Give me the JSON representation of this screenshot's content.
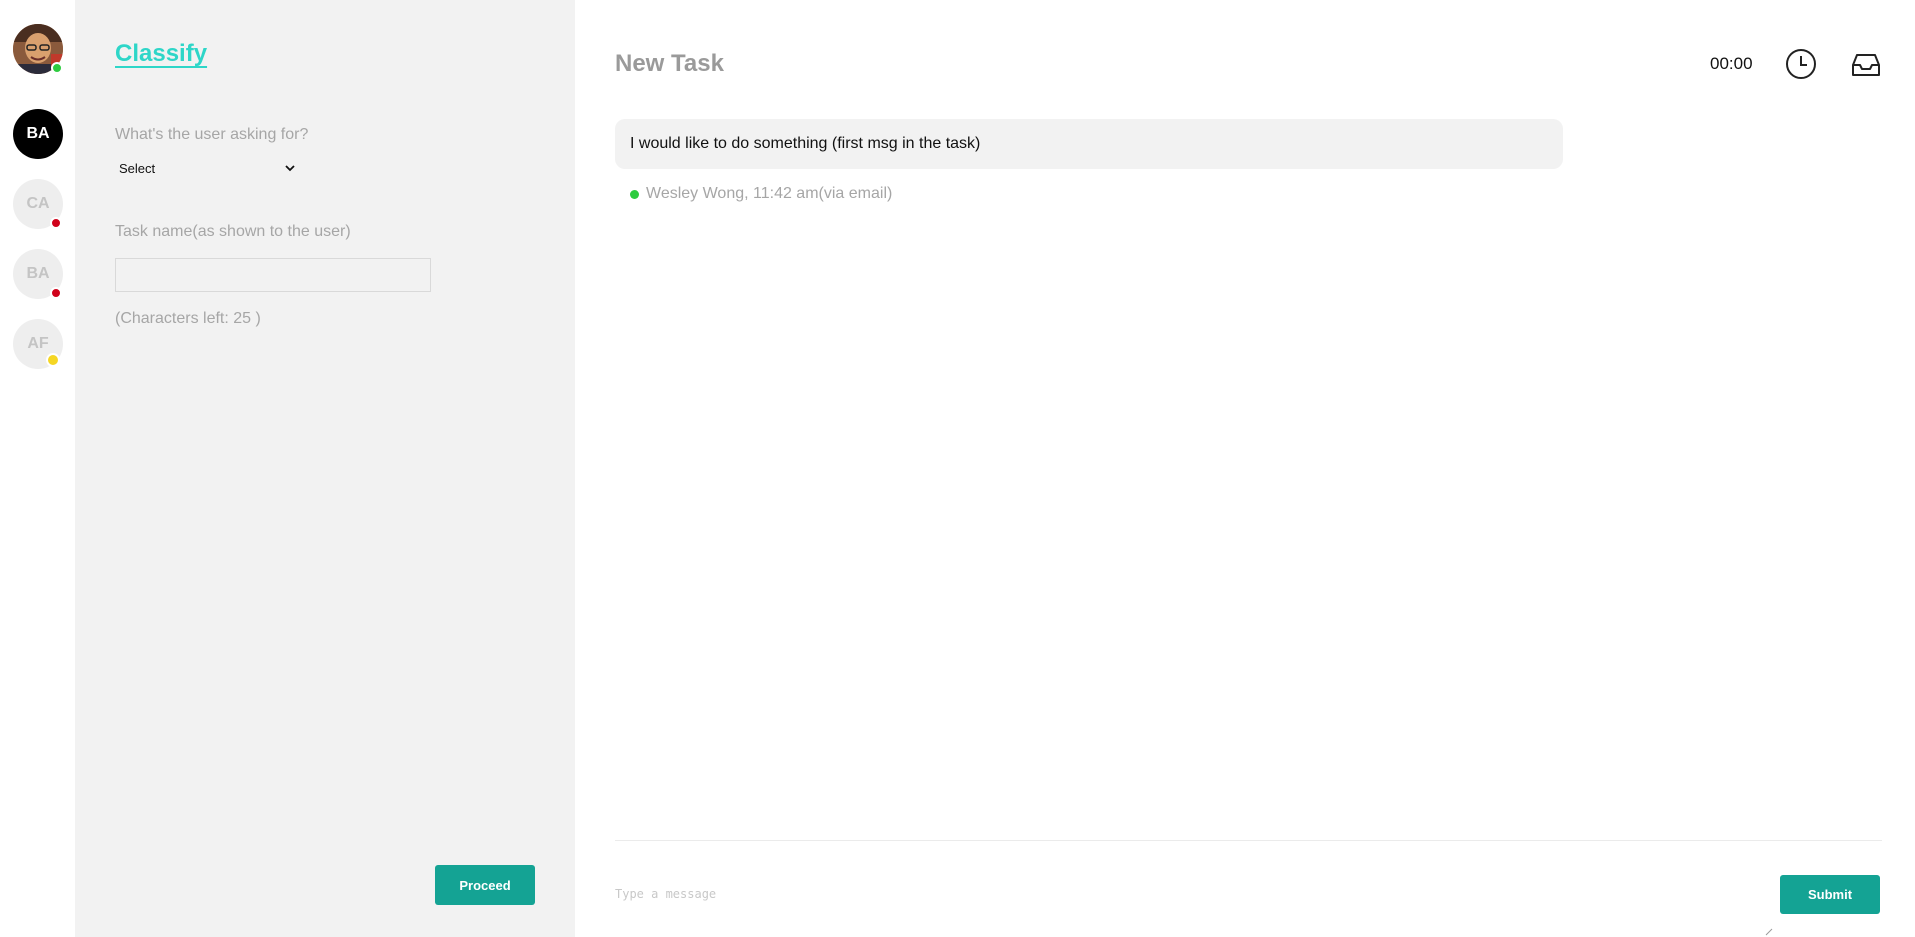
{
  "rail": {
    "user_status_color": "#2ecc40",
    "items": [
      {
        "initials": "BA",
        "active": true
      },
      {
        "initials": "CA",
        "status_color": "#d0021b"
      },
      {
        "initials": "BA",
        "status_color": "#d0021b"
      },
      {
        "initials": "AF",
        "status_color": "#f5d623"
      }
    ]
  },
  "classify": {
    "brand": "Classify",
    "question_label": "What's the user asking for?",
    "select_value": "Select",
    "task_name_label": "Task name(as shown to the user)",
    "task_name_value": "",
    "chars_left": "(Characters left: 25 )",
    "proceed_label": "Proceed"
  },
  "main": {
    "title": "New Task",
    "timer": "00:00",
    "message": {
      "text": "I would like to do something (first msg in the task)",
      "meta": "Wesley Wong, 11:42 am(via email)",
      "status_color": "#2ecc40"
    },
    "composer": {
      "placeholder": "Type a message",
      "submit_label": "Submit"
    }
  },
  "colors": {
    "accent": "#14a394",
    "brand": "#2ed6c8",
    "panel_bg": "#f2f2f2"
  },
  "icons": [
    "clock-icon",
    "inbox-icon",
    "chevron-down-icon"
  ]
}
